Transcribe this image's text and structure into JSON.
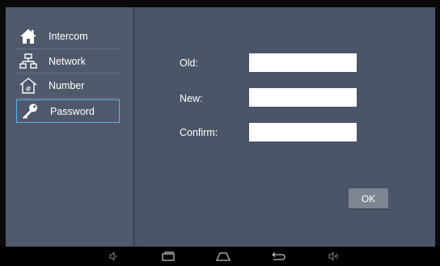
{
  "sidebar": {
    "items": [
      {
        "label": "Intercom",
        "icon": "home-icon"
      },
      {
        "label": "Network",
        "icon": "network-icon"
      },
      {
        "label": "Number",
        "icon": "number-icon"
      },
      {
        "label": "Password",
        "icon": "key-icon",
        "selected": true
      }
    ]
  },
  "form": {
    "old_label": "Old:",
    "new_label": "New:",
    "confirm_label": "Confirm:",
    "old_value": "",
    "new_value": "",
    "confirm_value": "",
    "ok_label": "OK"
  },
  "navbar": {
    "buttons": [
      "volume-down-icon",
      "recent-apps-icon",
      "home-icon",
      "back-icon",
      "volume-up-icon"
    ]
  },
  "colors": {
    "background": "#4b5568",
    "selection_border": "#5fb3e6",
    "button": "#7f8492"
  }
}
